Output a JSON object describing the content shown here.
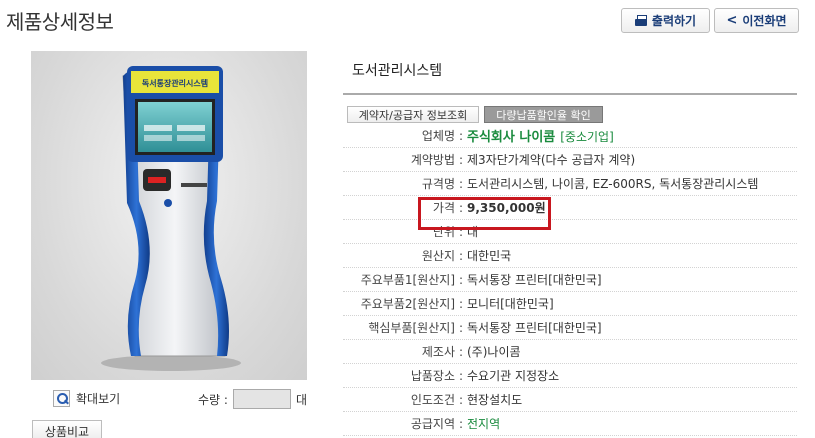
{
  "header": {
    "title": "제품상세정보",
    "print_label": "출력하기",
    "back_label": "이전화면"
  },
  "product": {
    "name": "도서관리시스템",
    "contract_info_button": "계약자/공급자 정보조회",
    "discount_button": "다량납품할인율 확인",
    "image_alt": "도서관리시스템 키오스크"
  },
  "image_controls": {
    "zoom_label": "확대보기",
    "quantity_label": "수량 :",
    "quantity_value": "",
    "quantity_unit": "대",
    "compare_label": "상품비교"
  },
  "details": [
    {
      "label": "업체명",
      "value": "주식회사 나이콤",
      "tag": "[중소기업]"
    },
    {
      "label": "계약방법",
      "value": "제3자단가계약(다수 공급자 계약)"
    },
    {
      "label": "규격명",
      "value": "도서관리시스템, 나이콤, EZ-600RS, 독서통장관리시스템"
    },
    {
      "label": "가격",
      "value": "9,350,000원"
    },
    {
      "label": "단위",
      "value": "대"
    },
    {
      "label": "원산지",
      "value": "대한민국"
    },
    {
      "label": "주요부품1[원산지]",
      "value": "독서통장 프린터[대한민국]"
    },
    {
      "label": "주요부품2[원산지]",
      "value": "모니터[대한민국]"
    },
    {
      "label": "핵심부품[원산지]",
      "value": "독서통장 프린터[대한민국]"
    },
    {
      "label": "제조사",
      "value": "(주)나이콤"
    },
    {
      "label": "납품장소",
      "value": "수요기관 지정장소"
    },
    {
      "label": "인도조건",
      "value": "현장설치도"
    },
    {
      "label": "공급지역",
      "value": "전지역"
    }
  ],
  "kiosk_screen_text": "독서통장관리시스템",
  "colors": {
    "accent_green": "#1a8b3e",
    "highlight_red": "#c8171f",
    "button_blue": "#1a3d78",
    "kiosk_blue": "#1f5fc4"
  }
}
